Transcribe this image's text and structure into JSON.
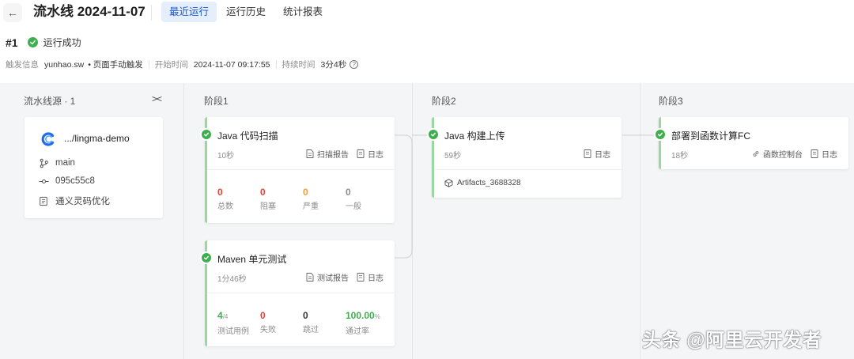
{
  "header": {
    "title": "流水线 2024-11-07",
    "tabs": [
      {
        "label": "最近运行",
        "active": true
      },
      {
        "label": "运行历史",
        "active": false
      },
      {
        "label": "统计报表",
        "active": false
      }
    ]
  },
  "run": {
    "number": "#1",
    "status": "运行成功",
    "trigger_label": "触发信息",
    "trigger_user": "yunhao.sw",
    "trigger_mode": "• 页面手动触发",
    "start_label": "开始时间",
    "start_time": "2024-11-07 09:17:55",
    "duration_label": "持续时间",
    "duration": "3分4秒",
    "help_icon": "?"
  },
  "columns": {
    "source": "流水线源 · 1",
    "stage1": "阶段1",
    "stage2": "阶段2",
    "stage3": "阶段3"
  },
  "source": {
    "repo": ".../lingma-demo",
    "branch": "main",
    "commit": "095c55c8",
    "message": "通义灵码优化"
  },
  "jobs": {
    "scan": {
      "title": "Java 代码扫描",
      "duration": "10秒",
      "report": "扫描报告",
      "log": "日志",
      "stats": [
        {
          "value": "0",
          "label": "总数",
          "color": "#d9453b"
        },
        {
          "value": "0",
          "label": "阻塞",
          "color": "#d9453b"
        },
        {
          "value": "0",
          "label": "严重",
          "color": "#f09a3e"
        },
        {
          "value": "0",
          "label": "一般",
          "color": "#8c8c8c"
        }
      ]
    },
    "maven": {
      "title": "Maven 单元测试",
      "duration": "1分46秒",
      "report": "测试报告",
      "log": "日志",
      "stats": [
        {
          "value": "4",
          "suffix": "/4",
          "label": "测试用例",
          "color": "#3fae4f"
        },
        {
          "value": "0",
          "label": "失败",
          "color": "#d9453b"
        },
        {
          "value": "0",
          "label": "跳过",
          "color": "#333333"
        },
        {
          "value": "100.00",
          "suffix": "%",
          "label": "通过率",
          "color": "#3fae4f"
        }
      ]
    },
    "build": {
      "title": "Java 构建上传",
      "duration": "59秒",
      "log": "日志",
      "artifact": "Artifacts_3688328"
    },
    "deploy": {
      "title": "部署到函数计算FC",
      "duration": "18秒",
      "console": "函数控制台",
      "log": "日志"
    }
  },
  "watermark": "头条 @阿里云开发者",
  "colors": {
    "success": "#3fae4f",
    "accent": "#1b59c7",
    "danger": "#d9453b",
    "warning": "#f09a3e"
  }
}
